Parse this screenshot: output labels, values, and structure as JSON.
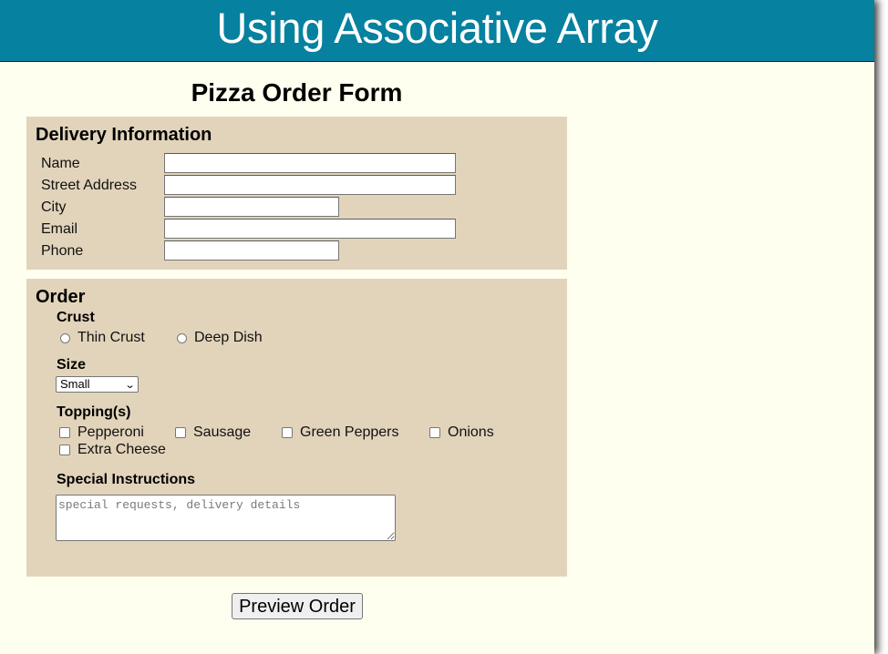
{
  "banner": {
    "title": "Using Associative Array",
    "color": "#06819f"
  },
  "form": {
    "title": "Pizza Order Form",
    "delivery": {
      "heading": "Delivery Information",
      "fields": [
        {
          "label": "Name",
          "value": ""
        },
        {
          "label": "Street Address",
          "value": ""
        },
        {
          "label": "City",
          "value": ""
        },
        {
          "label": "Email",
          "value": ""
        },
        {
          "label": "Phone",
          "value": ""
        }
      ]
    },
    "order": {
      "heading": "Order",
      "crust": {
        "label": "Crust",
        "options": [
          "Thin Crust",
          "Deep Dish"
        ]
      },
      "size": {
        "label": "Size",
        "selected": "Small"
      },
      "toppings": {
        "label": "Topping(s)",
        "options": [
          "Pepperoni",
          "Sausage",
          "Green Peppers",
          "Onions",
          "Extra Cheese"
        ]
      },
      "instructions": {
        "label": "Special Instructions",
        "placeholder": "special requests, delivery details",
        "value": ""
      }
    },
    "submit_label": "Preview Order"
  },
  "colors": {
    "page_background": "#ffffef",
    "section_background": "#e2d4bb"
  }
}
